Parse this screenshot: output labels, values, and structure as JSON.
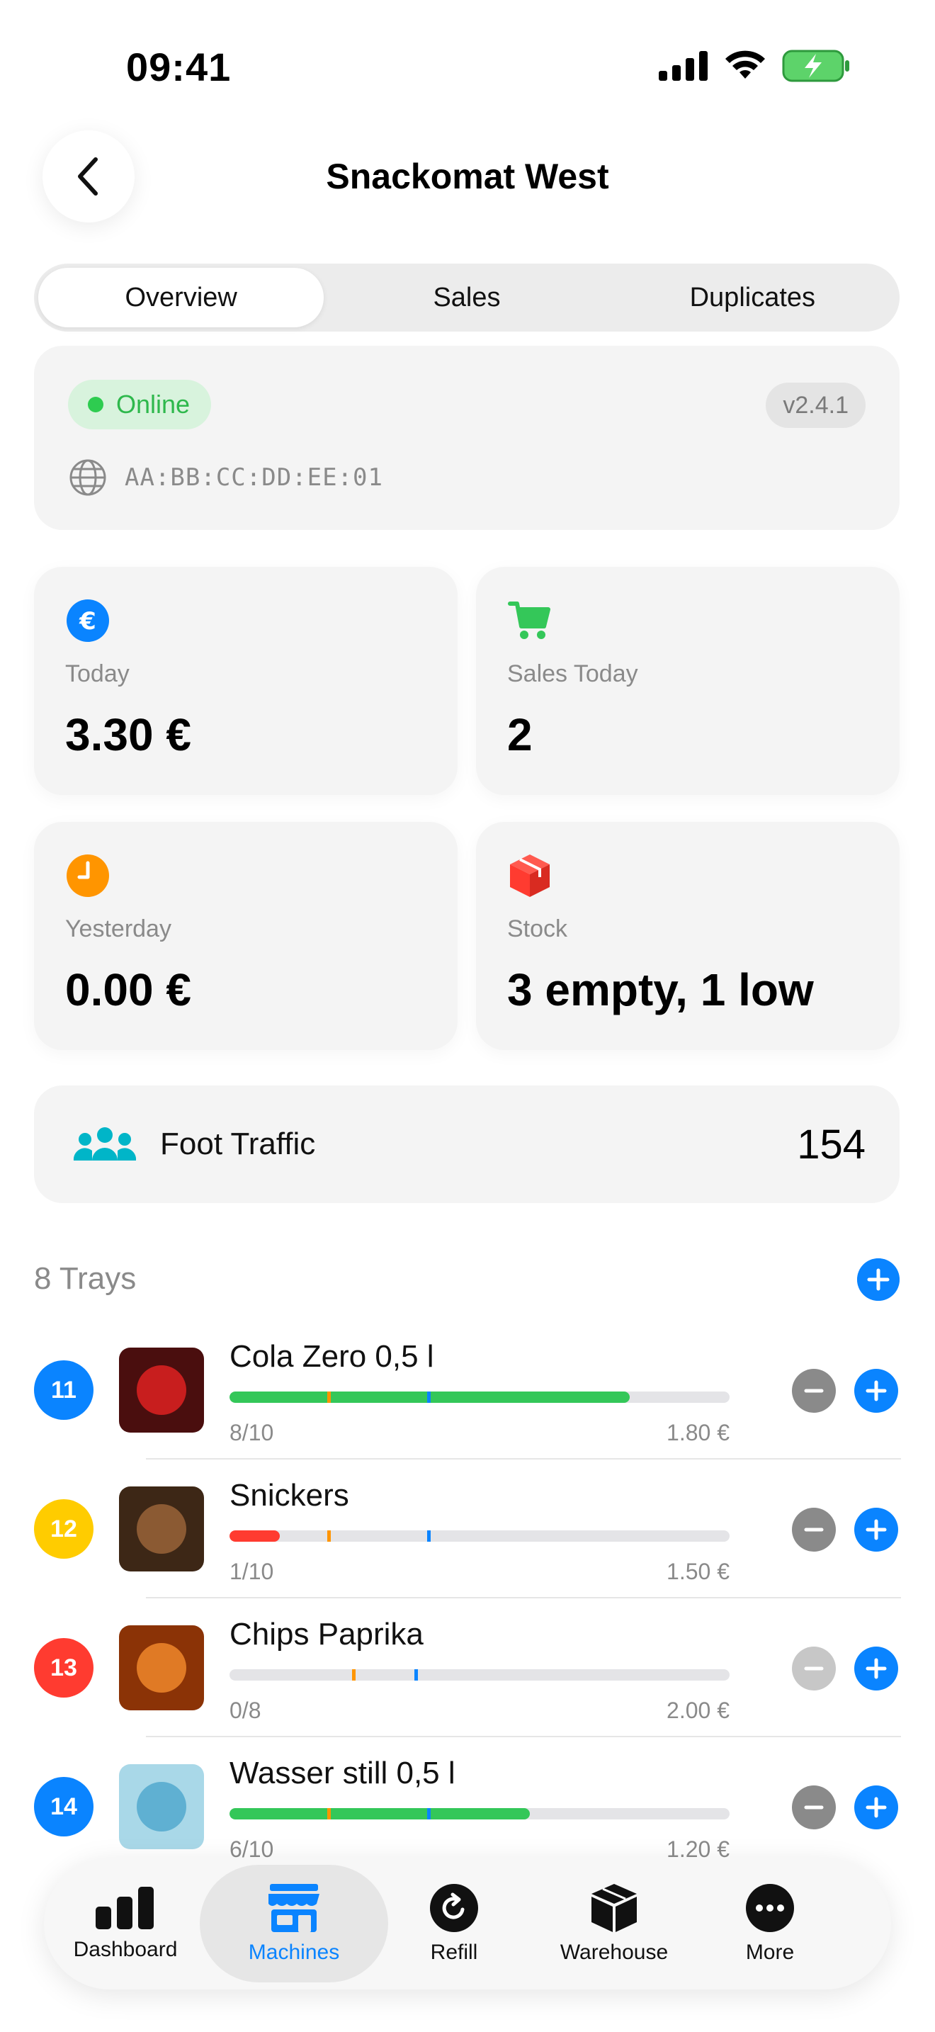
{
  "status_bar": {
    "time": "09:41"
  },
  "nav": {
    "title": "Snackomat West"
  },
  "segments": [
    "Overview",
    "Sales",
    "Duplicates"
  ],
  "machine": {
    "status": "Online",
    "version": "v2.4.1",
    "mac": "AA:BB:CC:DD:EE:01"
  },
  "stats": {
    "today": {
      "label": "Today",
      "value": "3.30 €"
    },
    "sales_today": {
      "label": "Sales Today",
      "value": "2"
    },
    "yesterday": {
      "label": "Yesterday",
      "value": "0.00 €"
    },
    "stock": {
      "label": "Stock",
      "value": "3 empty, 1 low"
    }
  },
  "traffic": {
    "label": "Foot Traffic",
    "value": "154"
  },
  "trays": {
    "title": "8 Trays",
    "items": [
      {
        "number": "11",
        "name": "Cola Zero 0,5 l",
        "count": "8/10",
        "price": "1.80 €",
        "fill_pct": 80,
        "badge_color": "#0a84ff",
        "img_bg": "#4a0e0e",
        "img_fg": "#c81e1e",
        "fill_color": "#34c759"
      },
      {
        "number": "12",
        "name": "Snickers",
        "count": "1/10",
        "price": "1.50 €",
        "fill_pct": 10,
        "badge_color": "#ffcc00",
        "img_bg": "#3d2716",
        "img_fg": "#8b5a33",
        "fill_color": "#ff3b30"
      },
      {
        "number": "13",
        "name": "Chips Paprika",
        "count": "0/8",
        "price": "2.00 €",
        "fill_pct": 0,
        "badge_color": "#ff3b30",
        "img_bg": "#8b3306",
        "img_fg": "#e07a25",
        "fill_color": "#34c759"
      },
      {
        "number": "14",
        "name": "Wasser still 0,5 l",
        "count": "6/10",
        "price": "1.20 €",
        "fill_pct": 60,
        "badge_color": "#0a84ff",
        "img_bg": "#a9d8e8",
        "img_fg": "#5fb0d2",
        "fill_color": "#34c759"
      }
    ]
  },
  "tabs": [
    {
      "label": "Dashboard",
      "icon": "chart-bar-icon"
    },
    {
      "label": "Machines",
      "icon": "storefront-icon"
    },
    {
      "label": "Refill",
      "icon": "refill-icon"
    },
    {
      "label": "Warehouse",
      "icon": "box-icon"
    },
    {
      "label": "More",
      "icon": "more-icon"
    }
  ],
  "colors": {
    "accent": "#0a84ff",
    "online": "#2eb84c",
    "cart": "#34c759",
    "clock": "#ff9500",
    "stock": "#ff3b30",
    "traffic": "#00b5c8"
  }
}
